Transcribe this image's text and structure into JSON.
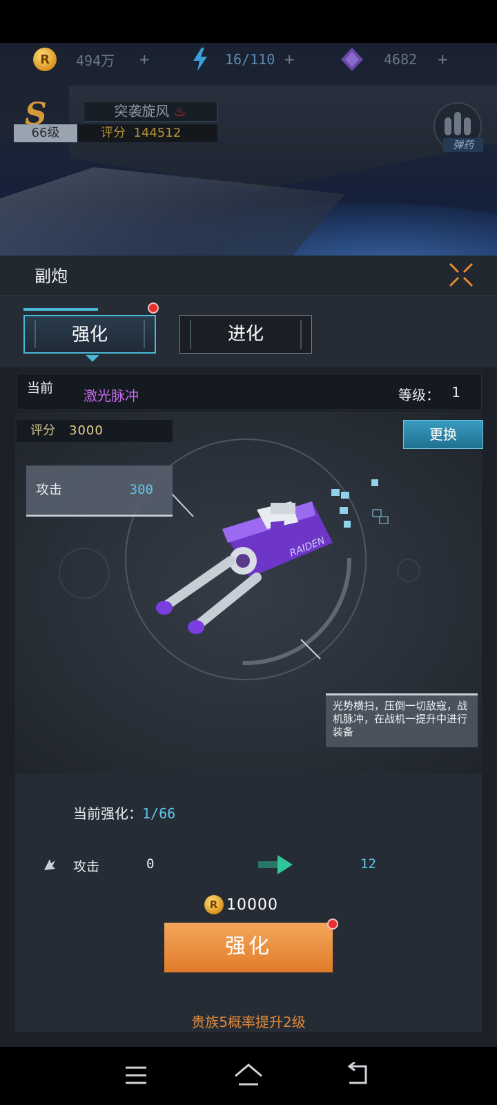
{
  "resources": [
    {
      "icon": "gold-coin-icon",
      "value": "494万"
    },
    {
      "icon": "lightning-energy-icon",
      "value": "16/110"
    },
    {
      "icon": "purple-gem-icon",
      "value": "4682"
    }
  ],
  "resource_plus": "+",
  "player": {
    "rank_badge": "S",
    "ship_name": "突袭旋风",
    "level": "66级",
    "score_label": "评分",
    "score": "144512"
  },
  "ammo_button": {
    "label": "弹药"
  },
  "panel": {
    "title": "副炮",
    "tabs": [
      {
        "label": "强化",
        "active": true
      },
      {
        "label": "进化",
        "active": false
      }
    ]
  },
  "current": {
    "label": "当前",
    "weapon_name": "激光脉冲",
    "level_label": "等级：",
    "level_value": "1"
  },
  "rating": {
    "label": "评分",
    "value": "3000"
  },
  "swap_button": "更换",
  "attack_stat": {
    "label": "攻击",
    "value": "300"
  },
  "description": "光势横扫，压倒一切敌寇，战机脉冲，在战机一提升中进行装备",
  "upgrade": {
    "progress_label": "当前强化：",
    "progress_value": "1/66",
    "stat_label": "攻击",
    "stat_from": "0",
    "stat_to": "12",
    "cost": "10000",
    "button_label": "强化"
  },
  "noble_text": "贵族5概率提升2级",
  "colors": {
    "accent": "#49b8d6",
    "orange": "#e88a36",
    "purple": "#c46bf0",
    "cyan": "#5fc6e8",
    "dot": "#e53030"
  }
}
